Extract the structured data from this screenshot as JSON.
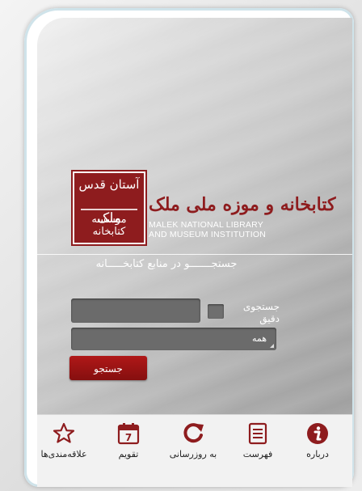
{
  "header": {
    "seal_top": "آستان قدس",
    "seal_main": "ملک",
    "seal_bottom": "موسسه کتابخانه",
    "logo_text_fa": "کتابخانه و موزه ملی ملک",
    "logo_text_en_line1": "MALEK NATIONAL LIBRARY",
    "logo_text_en_line2": "AND MUSEUM INSTITUTION"
  },
  "search": {
    "title": "جستجـــــــو در منابع کتابخـــــانه",
    "exact_label_line1": "جستجوی",
    "exact_label_line2": "دقیق",
    "scope_value": "همه",
    "submit_label": "جستجو"
  },
  "tabbar": {
    "items": [
      {
        "label": "علاقه‌مندی‌ها",
        "icon": "star-icon"
      },
      {
        "label": "تقویم",
        "icon": "calendar-icon"
      },
      {
        "label": "به روزرسانی",
        "icon": "refresh-icon"
      },
      {
        "label": "فهرست",
        "icon": "list-icon"
      },
      {
        "label": "درباره",
        "icon": "info-icon"
      }
    ],
    "calendar_day": "7"
  },
  "colors": {
    "brand_red": "#8e1c1e",
    "button_red": "#a41515"
  }
}
